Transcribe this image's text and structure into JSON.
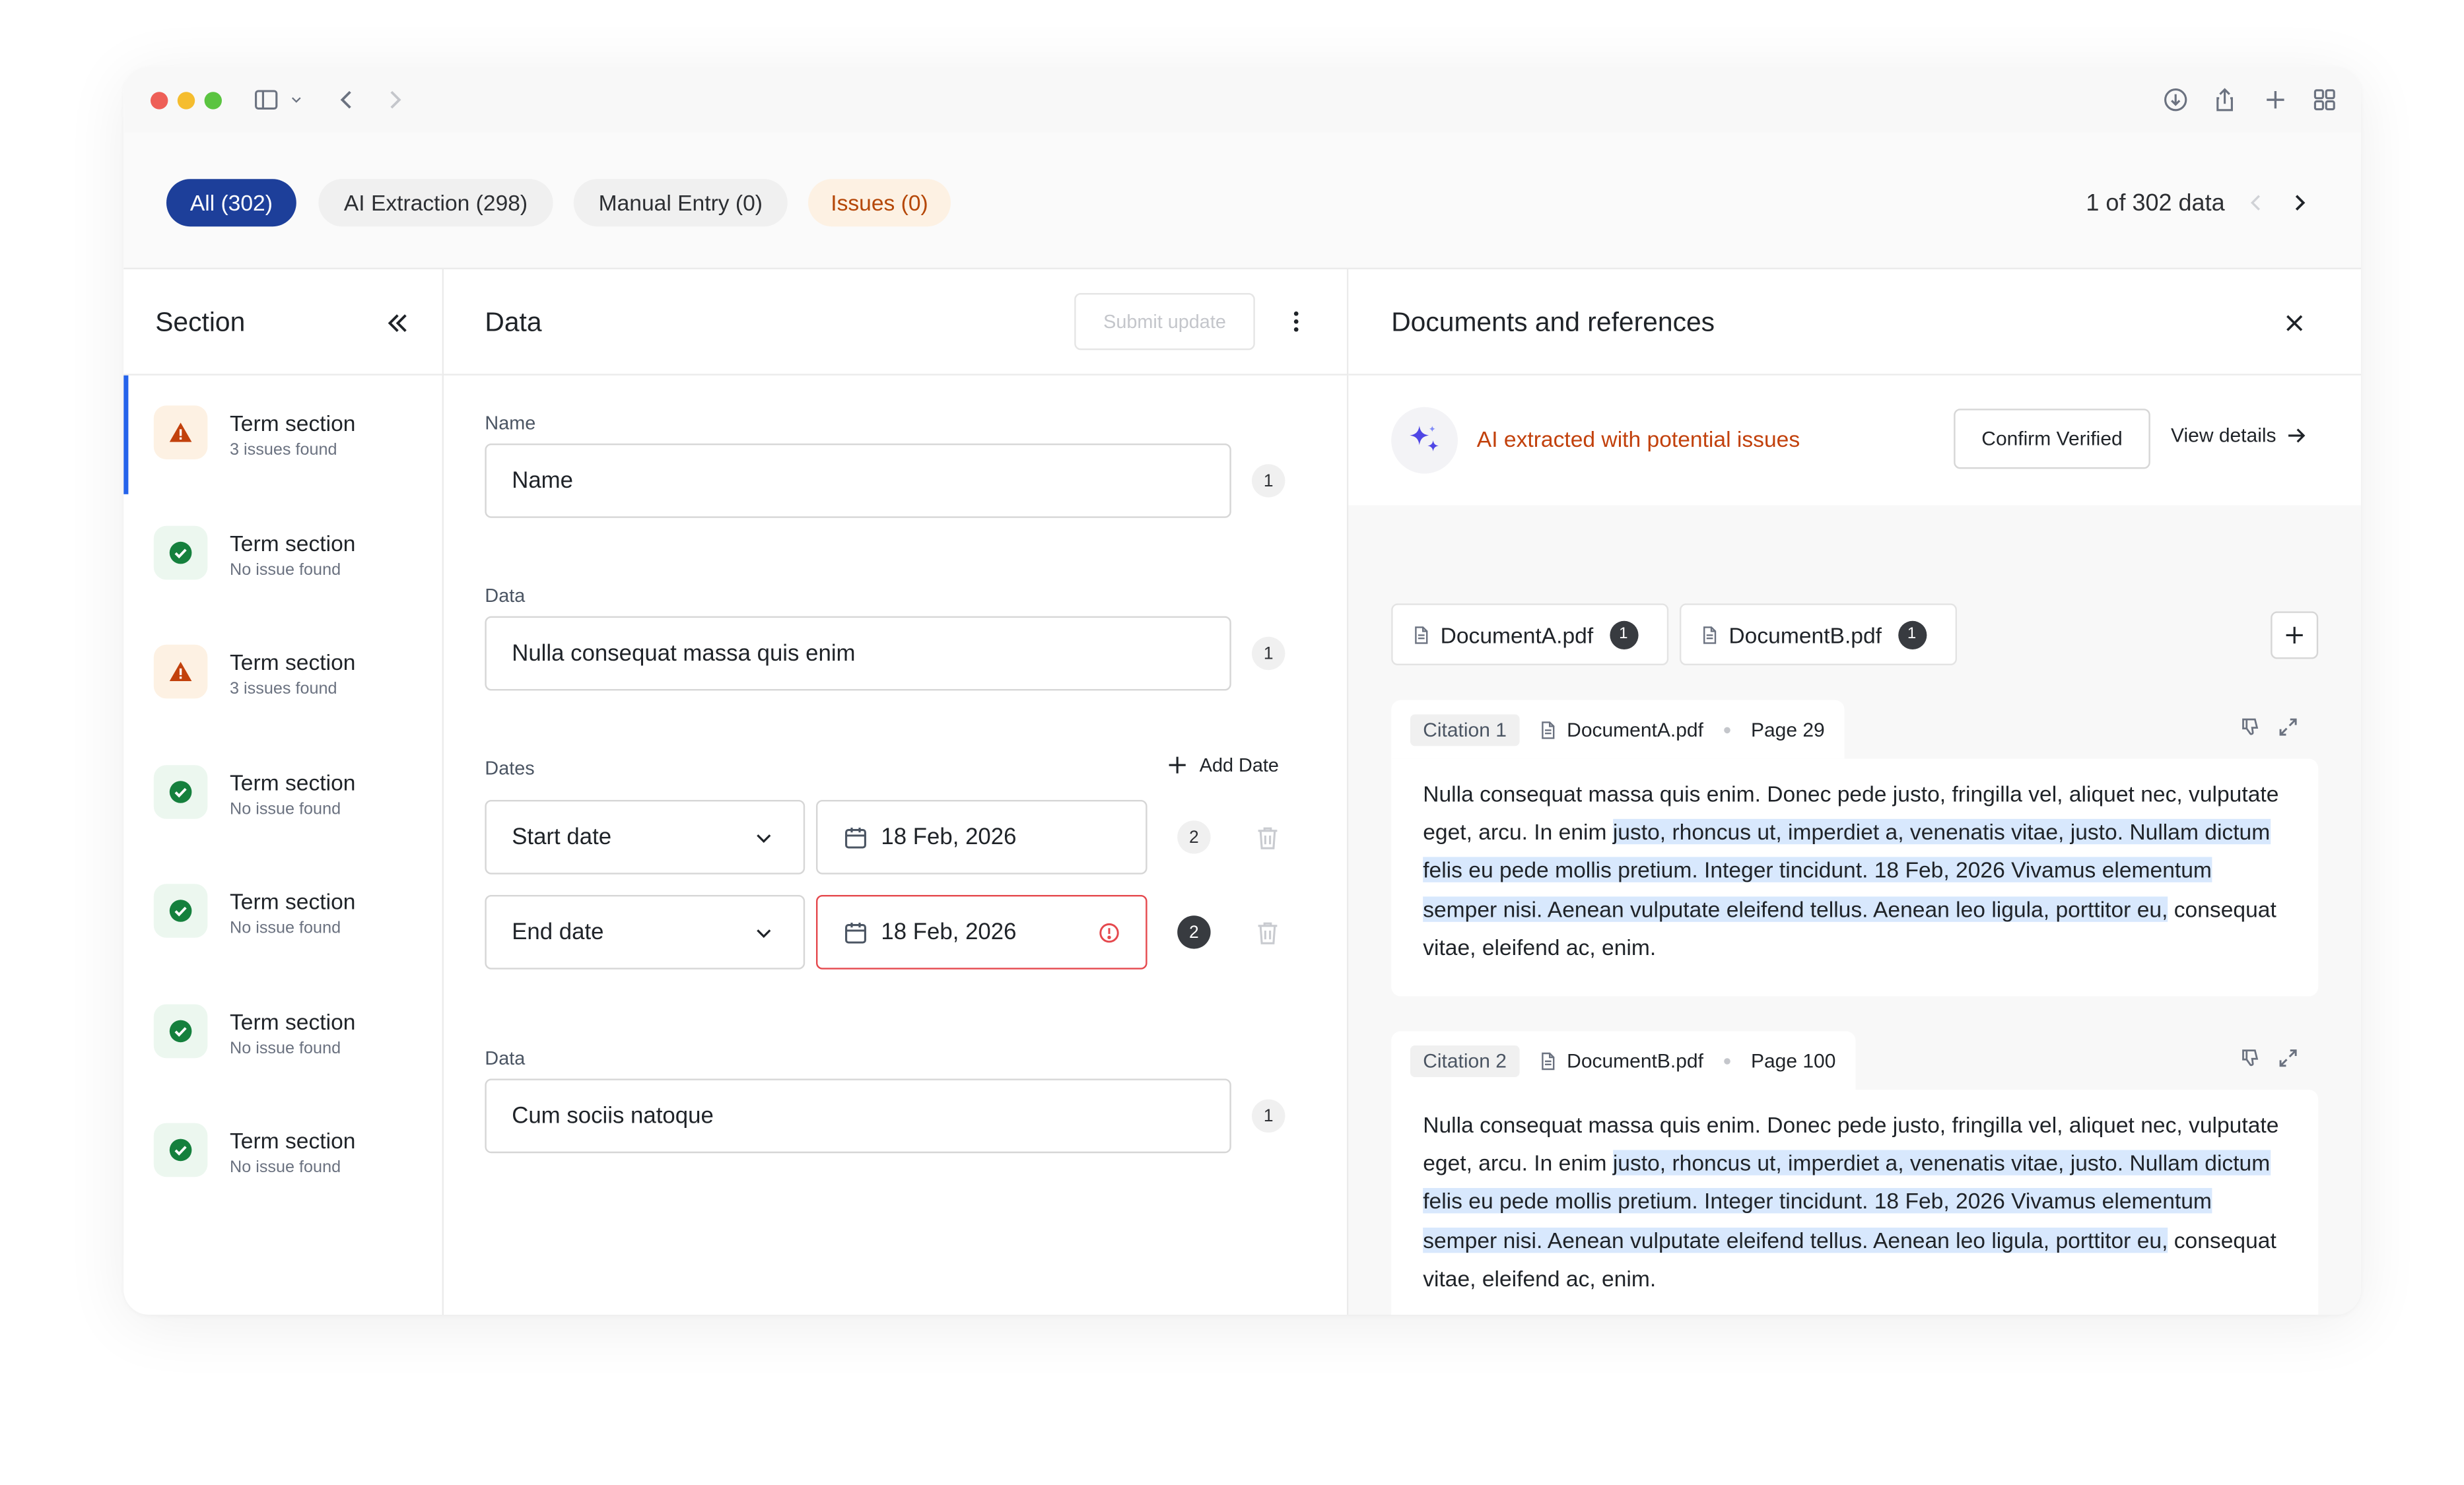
{
  "filters": {
    "all": "All (302)",
    "ai_extraction": "AI Extraction (298)",
    "manual_entry": "Manual Entry (0)",
    "issues": "Issues (0)"
  },
  "pager": {
    "text": "1 of 302 data"
  },
  "section_panel": {
    "title": "Section",
    "items": [
      {
        "title": "Term section",
        "sub": "3 issues found",
        "status": "warning"
      },
      {
        "title": "Term section",
        "sub": "No issue found",
        "status": "ok"
      },
      {
        "title": "Term section",
        "sub": "3 issues found",
        "status": "warning"
      },
      {
        "title": "Term section",
        "sub": "No issue found",
        "status": "ok"
      },
      {
        "title": "Term section",
        "sub": "No issue found",
        "status": "ok"
      },
      {
        "title": "Term section",
        "sub": "No issue found",
        "status": "ok"
      },
      {
        "title": "Term section",
        "sub": "No issue found",
        "status": "ok"
      }
    ]
  },
  "data_panel": {
    "title": "Data",
    "submit_label": "Submit update",
    "name_label": "Name",
    "name_value": "Name",
    "name_count": "1",
    "data_label": "Data",
    "data_value": "Nulla consequat massa quis enim",
    "data_count": "1",
    "dates_label": "Dates",
    "add_date_label": "Add Date",
    "start_select": "Start date",
    "start_value": "18 Feb, 2026",
    "start_count": "2",
    "end_select": "End date",
    "end_value": "18 Feb, 2026",
    "end_count": "2",
    "data2_label": "Data",
    "data2_value": "Cum sociis natoque",
    "data2_count": "1"
  },
  "docs_panel": {
    "title": "Documents and references",
    "ai_status": "AI extracted with potential issues",
    "confirm_label": "Confirm Verified",
    "view_details_label": "View details",
    "documents": [
      {
        "name": "DocumentA.pdf",
        "count": "1"
      },
      {
        "name": "DocumentB.pdf",
        "count": "1"
      }
    ],
    "citations": [
      {
        "tag": "Citation 1",
        "doc": "DocumentA.pdf",
        "page": "Page 29",
        "text_before": "Nulla consequat massa quis enim. Donec pede justo, fringilla vel, aliquet nec, vulputate eget, arcu. In enim ",
        "text_highlight": "justo, rhoncus ut, imperdiet a, venenatis vitae, justo. Nullam dictum felis eu pede mollis pretium. Integer tincidunt. 18 Feb, 2026 Vivamus elementum semper nisi. Aenean vulputate eleifend tellus. Aenean leo ligula, porttitor eu,",
        "text_after": " consequat vitae, eleifend ac, enim."
      },
      {
        "tag": "Citation 2",
        "doc": "DocumentB.pdf",
        "page": "Page 100",
        "text_before": "Nulla consequat massa quis enim. Donec pede justo, fringilla vel, aliquet nec, vulputate eget, arcu. In enim ",
        "text_highlight": "justo, rhoncus ut, imperdiet a, venenatis vitae, justo. Nullam dictum felis eu pede mollis pretium. Integer tincidunt. 18 Feb, 2026 Vivamus elementum semper nisi. Aenean vulputate eleifend tellus. Aenean leo ligula, porttitor eu,",
        "text_after": " consequat vitae, eleifend ac, enim."
      }
    ]
  },
  "colors": {
    "accent": "#1d3f9a",
    "warning": "#c2410c",
    "success": "#15803d",
    "error": "#e5484d",
    "highlight": "#d8e8fd"
  }
}
